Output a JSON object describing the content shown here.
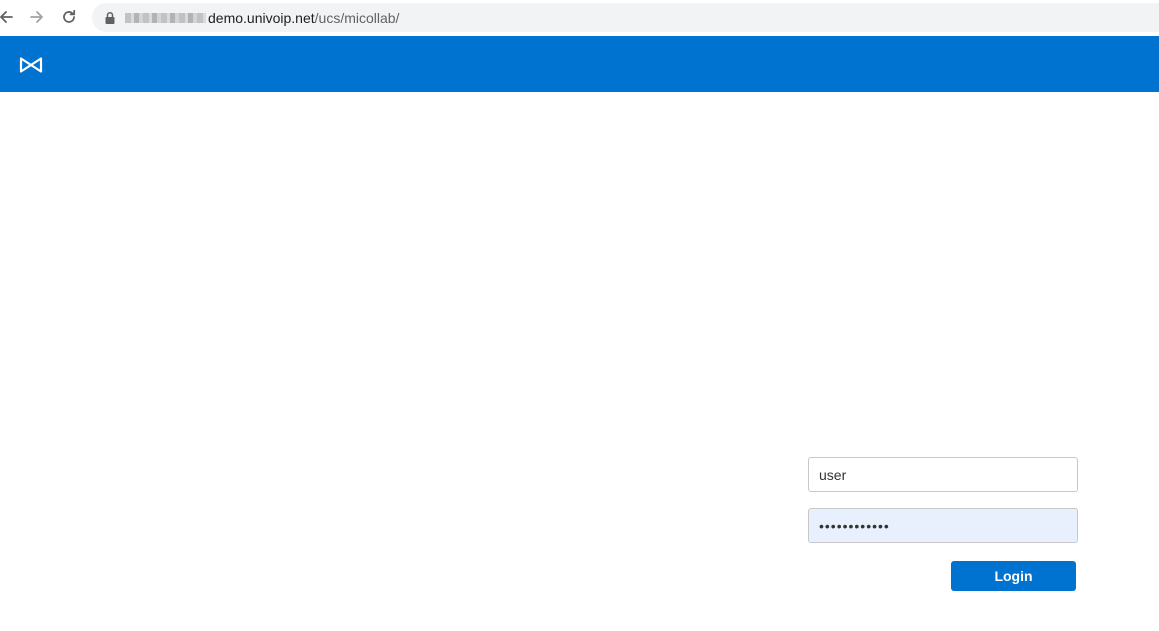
{
  "browser": {
    "url_host": "demo.univoip.net",
    "url_path": "/ucs/micollab/",
    "icons": {
      "back": "back-arrow-icon",
      "forward": "forward-arrow-icon",
      "reload": "reload-icon",
      "lock": "lock-icon"
    }
  },
  "header": {
    "logo_icon": "micollab-logo-icon",
    "background_color": "#0073d0"
  },
  "login": {
    "username_value": "user",
    "password_value": "••••••••••••",
    "login_label": "Login",
    "button_color": "#0073d0",
    "password_autofill_color": "#e8f0fe"
  }
}
